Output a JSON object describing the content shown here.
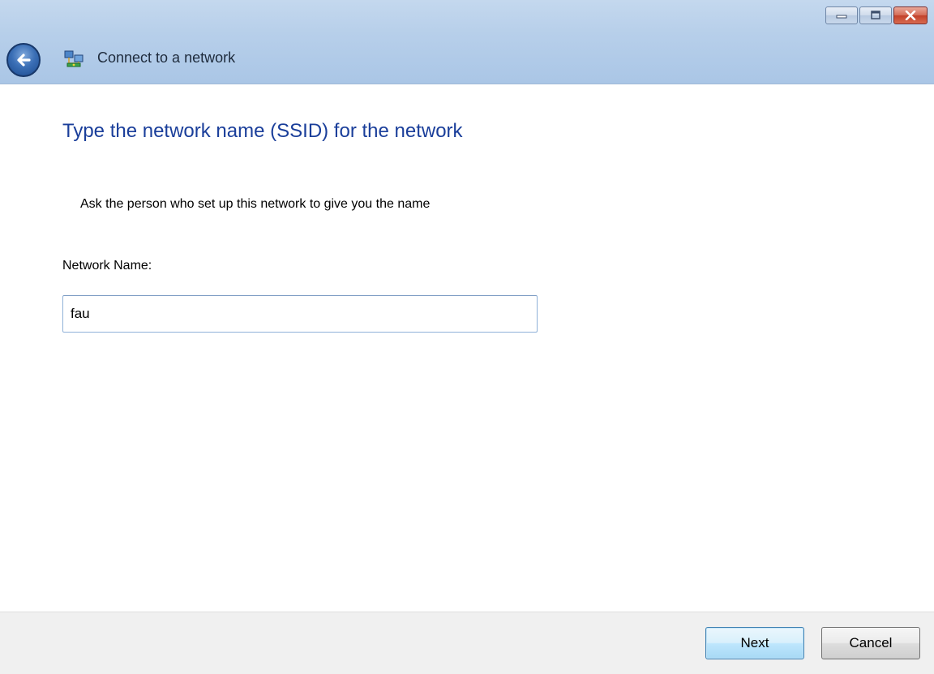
{
  "window": {
    "title": "Connect to a network",
    "controls": {
      "minimize_icon": "minimize-icon",
      "maximize_icon": "maximize-icon",
      "close_icon": "close-icon"
    },
    "back_icon": "back-arrow-icon",
    "app_icon": "network-icon"
  },
  "main": {
    "heading": "Type the network name (SSID) for the network",
    "instructions": "Ask the person who set up this network to give you the name",
    "field_label": "Network Name:",
    "network_name_value": "fau"
  },
  "footer": {
    "next_label": "Next",
    "cancel_label": "Cancel"
  },
  "colors": {
    "heading": "#1a3e9a",
    "titlebar": "#b7cfea",
    "footer": "#f0f0f0"
  }
}
